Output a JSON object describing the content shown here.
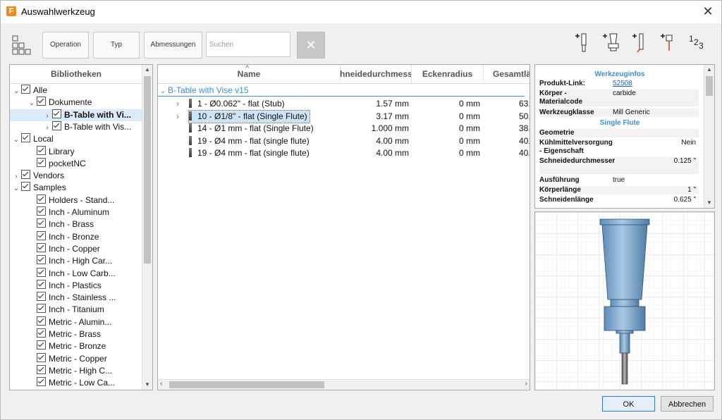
{
  "window": {
    "title": "Auswahlwerkzeug",
    "app_icon": "F"
  },
  "toolbar": {
    "buttons": [
      "Operation",
      "Typ",
      "Abmessungen"
    ],
    "search_placeholder": "Suchen",
    "numbering_label_1": "1",
    "numbering_label_2": "2",
    "numbering_label_3": "3"
  },
  "libraries": {
    "header": "Bibliotheken",
    "items": [
      {
        "label": "Alle",
        "level": 0,
        "expander": "open"
      },
      {
        "label": "Dokumente",
        "level": 1,
        "expander": "open"
      },
      {
        "label": "B-Table with Vi...",
        "level": 2,
        "expander": "closed",
        "selected": true,
        "bold": true
      },
      {
        "label": "B-Table with Vis...",
        "level": 2,
        "expander": "closed"
      },
      {
        "label": "Local",
        "level": 0,
        "expander": "open"
      },
      {
        "label": "Library",
        "level": 1,
        "expander": "none"
      },
      {
        "label": "pocketNC",
        "level": 1,
        "expander": "none"
      },
      {
        "label": "Vendors",
        "level": 0,
        "expander": "closed"
      },
      {
        "label": "Samples",
        "level": 0,
        "expander": "open"
      },
      {
        "label": "Holders - Stand...",
        "level": 1,
        "expander": "none"
      },
      {
        "label": "Inch - Aluminum",
        "level": 1,
        "expander": "none"
      },
      {
        "label": "Inch - Brass",
        "level": 1,
        "expander": "none"
      },
      {
        "label": "Inch - Bronze",
        "level": 1,
        "expander": "none"
      },
      {
        "label": "Inch - Copper",
        "level": 1,
        "expander": "none"
      },
      {
        "label": "Inch - High Car...",
        "level": 1,
        "expander": "none"
      },
      {
        "label": "Inch - Low Carb...",
        "level": 1,
        "expander": "none"
      },
      {
        "label": "Inch - Plastics",
        "level": 1,
        "expander": "none"
      },
      {
        "label": "Inch - Stainless ...",
        "level": 1,
        "expander": "none"
      },
      {
        "label": "Inch - Titanium",
        "level": 1,
        "expander": "none"
      },
      {
        "label": "Metric - Alumin...",
        "level": 1,
        "expander": "none"
      },
      {
        "label": "Metric - Brass",
        "level": 1,
        "expander": "none"
      },
      {
        "label": "Metric - Bronze",
        "level": 1,
        "expander": "none"
      },
      {
        "label": "Metric - Copper",
        "level": 1,
        "expander": "none"
      },
      {
        "label": "Metric - High C...",
        "level": 1,
        "expander": "none"
      },
      {
        "label": "Metric - Low Ca...",
        "level": 1,
        "expander": "none"
      }
    ]
  },
  "tools": {
    "columns": [
      "Name",
      "hneidedurchmess",
      "Eckenradius",
      "Gesamtlä"
    ],
    "group": "B-Table with Vise v15",
    "rows": [
      {
        "name": "1 - Ø0.062\" - flat (Stub)",
        "diameter": "1.57 mm",
        "radius": "0 mm",
        "length": "63.",
        "expander": true
      },
      {
        "name": "10 - Ø1/8\" - flat (Single Flute)",
        "diameter": "3.17 mm",
        "radius": "0 mm",
        "length": "50.",
        "expander": true,
        "selected": true
      },
      {
        "name": "14 - Ø1 mm - flat (Single Flute)",
        "diameter": "1.000 mm",
        "radius": "0 mm",
        "length": "38.",
        "expander": false
      },
      {
        "name": "19 - Ø4 mm - flat (single flute)",
        "diameter": "4.00 mm",
        "radius": "0 mm",
        "length": "40.",
        "expander": false
      },
      {
        "name": "19 - Ø4 mm - flat (single flute)",
        "diameter": "4.00 mm",
        "radius": "0 mm",
        "length": "40.",
        "expander": false
      }
    ]
  },
  "info": {
    "title": "Werkzeuginfos",
    "rows": [
      {
        "key": "Produkt-Link:",
        "value": "52508",
        "link": true
      },
      {
        "key": "Körper - Materialcode",
        "value": "carbide"
      },
      {
        "key": "Werkzeugklasse",
        "value": "Mill Generic"
      }
    ],
    "subtitle": "Single Flute",
    "section": "Geometrie",
    "rows2": [
      {
        "key": "Kühlmittelversorgung - Eigenschaft",
        "value": "Nein",
        "align": "right"
      },
      {
        "key": "Schneidedurchmesser",
        "value": "0.125 \"",
        "align": "right"
      },
      {
        "key": "Ausführung",
        "value": "true",
        "align": "left"
      },
      {
        "key": "Körperlänge",
        "value": "1 \"",
        "align": "right"
      },
      {
        "key": "Schneidenlänge",
        "value": "0.625 \"",
        "align": "right"
      }
    ]
  },
  "footer": {
    "ok": "OK",
    "cancel": "Abbrechen"
  },
  "colors": {
    "accent": "#3b8fd6",
    "selection": "#cde4f7",
    "tool_body": "#7fa8cc"
  }
}
